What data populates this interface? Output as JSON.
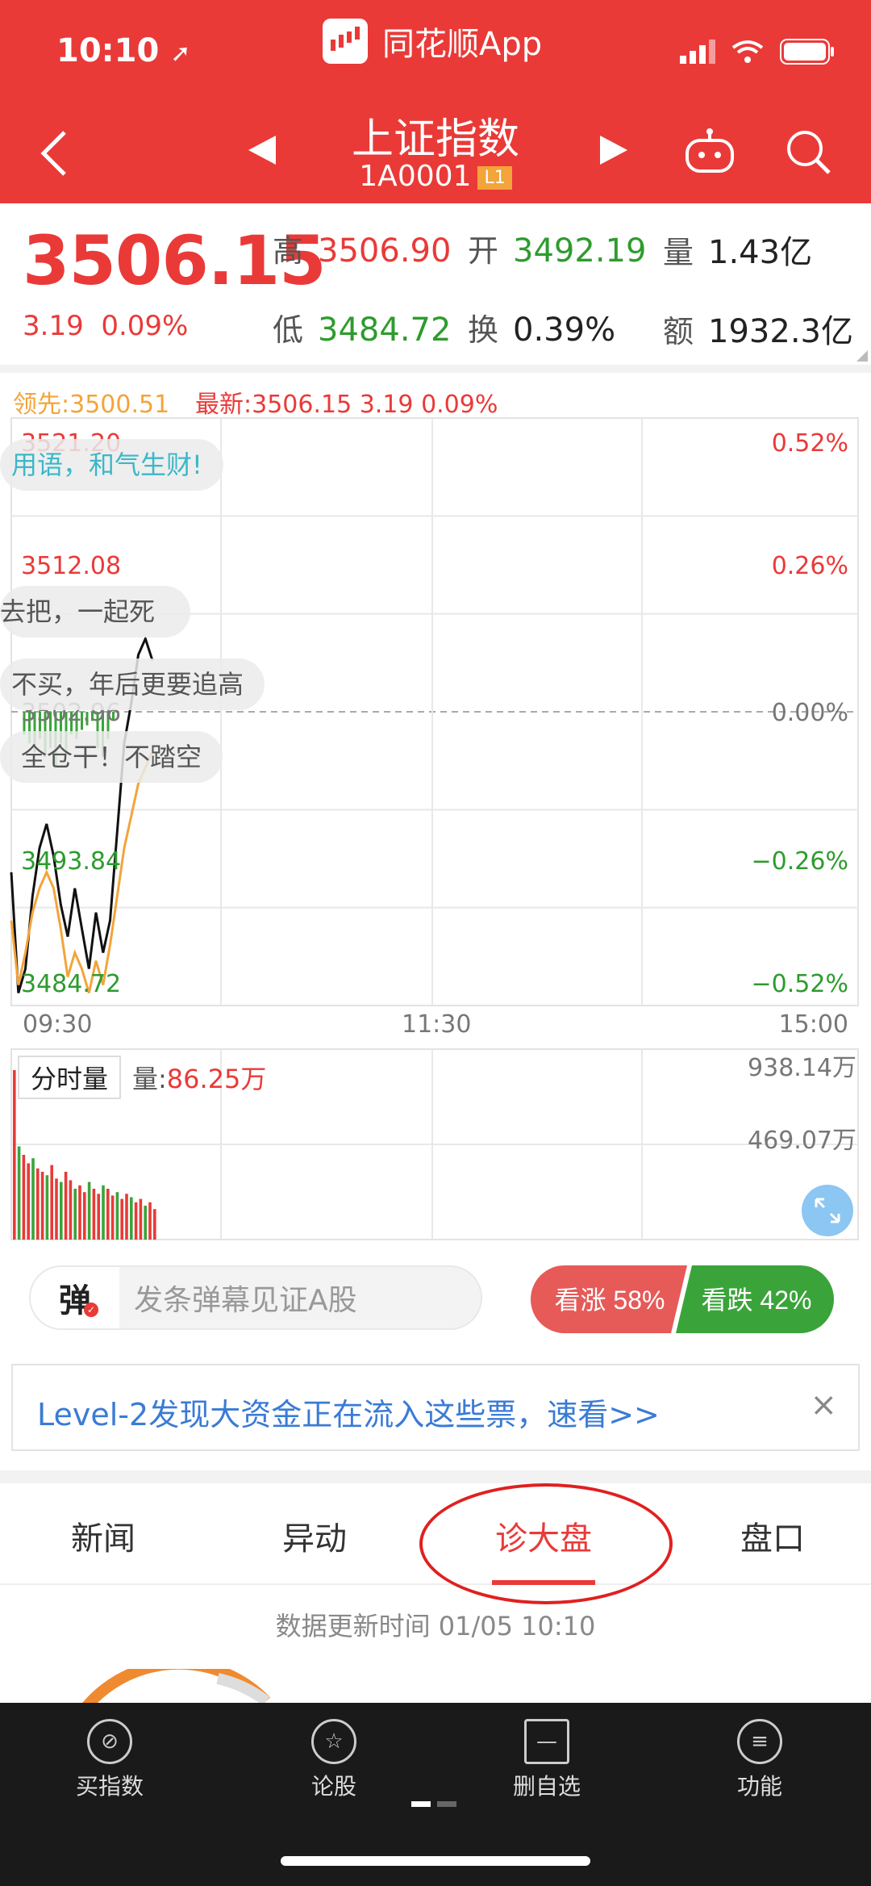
{
  "status": {
    "time": "10:10",
    "app_name": "同花顺App"
  },
  "nav": {
    "title": "上证指数",
    "code": "1A0001",
    "level": "L1"
  },
  "quote": {
    "price": "3506.15",
    "change": "3.19",
    "change_pct": "0.09%",
    "high_label": "高",
    "high": "3506.90",
    "open_label": "开",
    "open": "3492.19",
    "vol_label": "量",
    "vol": "1.43亿",
    "low_label": "低",
    "low": "3484.72",
    "turnover_label": "换",
    "turnover": "0.39%",
    "amount_label": "额",
    "amount": "1932.3亿"
  },
  "chart": {
    "lead_label": "领先:3500.51",
    "latest_label": "最新:3506.15",
    "latest_chg": "3.19",
    "latest_pct": "0.09%",
    "y_left": [
      "3521.20",
      "3512.08",
      "3502.96",
      "3493.84",
      "3484.72"
    ],
    "y_right": [
      "0.52%",
      "0.26%",
      "0.00%",
      "−0.26%",
      "−0.52%"
    ],
    "x_labels": [
      "09:30",
      "11:30",
      "15:00"
    ],
    "vol_tab": "分时量",
    "vol_label": "量:",
    "vol_value": "86.25万",
    "vol_max": "938.14万",
    "vol_mid": "469.07万"
  },
  "chart_data": {
    "type": "line",
    "series": [
      {
        "values": [
          3493.0,
          3485.5,
          3487.0,
          3491.5,
          3494.5,
          3496.0,
          3494.0,
          3491.0,
          3489.0,
          3492.0,
          3489.5,
          3487.0,
          3490.5,
          3488.0,
          3490.0,
          3495.5,
          3501.0,
          3503.5,
          3506.5,
          3507.5,
          3506.15
        ]
      },
      {
        "values": [
          3490.0,
          3486.0,
          3488.0,
          3490.5,
          3492.0,
          3493.0,
          3492.0,
          3489.5,
          3486.5,
          3488.0,
          3487.0,
          3485.5,
          3487.5,
          3486.0,
          3488.5,
          3491.5,
          3494.5,
          3496.5,
          3498.5,
          3499.5,
          3500.51
        ]
      }
    ],
    "ylim": [
      3484.72,
      3521.2
    ]
  },
  "danmu": [
    "用语，和气生财!",
    "去把，一起死",
    "不买，年后更要追高",
    "全仓干！不踏空"
  ],
  "danmu_bar": {
    "icon": "弹",
    "placeholder": "发条弹幕见证A股"
  },
  "vote": {
    "up": "看涨 58%",
    "down": "看跌 42%"
  },
  "banner": {
    "text": "Level-2发现大资金正在流入这些票，速看>>",
    "close": "×"
  },
  "tabs": [
    "新闻",
    "异动",
    "诊大盘",
    "盘口"
  ],
  "update_time": "数据更新时间 01/05  10:10",
  "bottom_nav": [
    "买指数",
    "论股",
    "删自选",
    "功能"
  ],
  "colors": {
    "brand": "#e93a38",
    "green": "#2e9b2e",
    "orange": "#f3a43a",
    "link": "#3a7bd5"
  }
}
